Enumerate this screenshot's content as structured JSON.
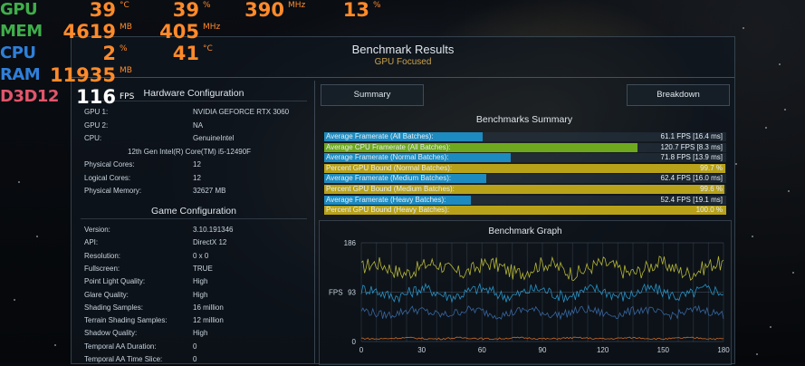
{
  "osd": {
    "rows": [
      {
        "label": "GPU",
        "label_color": "#3fae4a",
        "items": [
          {
            "value": "39",
            "unit": "°C"
          },
          {
            "value": "39",
            "unit": "%"
          },
          {
            "value": "390",
            "unit": "MHz"
          },
          {
            "value": "13",
            "unit": "%"
          }
        ]
      },
      {
        "label": "MEM",
        "label_color": "#3fae4a",
        "items": [
          {
            "value": "4619",
            "unit": "MB"
          },
          {
            "value": "405",
            "unit": "MHz"
          }
        ]
      },
      {
        "label": "CPU",
        "label_color": "#2f7fd8",
        "items": [
          {
            "value": "2",
            "unit": "%"
          },
          {
            "value": "41",
            "unit": "°C"
          }
        ]
      },
      {
        "label": "RAM",
        "label_color": "#2f7fd8",
        "items": [
          {
            "value": "11935",
            "unit": "MB"
          }
        ]
      },
      {
        "label": "D3D12",
        "label_color": "#e0566b",
        "items": [
          {
            "value": "116",
            "unit": "FPS"
          }
        ]
      }
    ],
    "value_color": "#ff8a2a",
    "fps_color": "#ffffff"
  },
  "panel": {
    "title": "Benchmark Results",
    "subtitle": "GPU Focused",
    "hardware_title": "Hardware Configuration",
    "hardware": [
      {
        "k": "GPU 1:",
        "v": "NVIDIA GEFORCE RTX 3060"
      },
      {
        "k": "GPU 2:",
        "v": "NA"
      },
      {
        "k": "CPU:",
        "v": "GenuineIntel"
      },
      {
        "k": "",
        "v": "12th Gen Intel(R) Core(TM) i5-12490F"
      },
      {
        "k": "Physical Cores:",
        "v": "12"
      },
      {
        "k": "Logical Cores:",
        "v": "12"
      },
      {
        "k": "Physical Memory:",
        "v": "32627  MB"
      }
    ],
    "game_title": "Game Configuration",
    "game": [
      {
        "k": "Version:",
        "v": "3.10.191346"
      },
      {
        "k": "API:",
        "v": "DirectX 12"
      },
      {
        "k": "Resolution:",
        "v": "0 x 0"
      },
      {
        "k": "Fullscreen:",
        "v": "TRUE"
      },
      {
        "k": "Point Light Quality:",
        "v": "High"
      },
      {
        "k": "Glare Quality:",
        "v": "High"
      },
      {
        "k": "Shading Samples:",
        "v": "16 million"
      },
      {
        "k": "Terrain Shading Samples:",
        "v": "12 million"
      },
      {
        "k": "Shadow Quality:",
        "v": "High"
      },
      {
        "k": "Temporal AA Duration:",
        "v": "0"
      },
      {
        "k": "Temporal AA Time Slice:",
        "v": "0"
      }
    ],
    "tabs": [
      {
        "label": "Summary"
      },
      {
        "label": "Breakdown"
      }
    ],
    "summary_title": "Benchmarks Summary",
    "bars": [
      {
        "label": "Average Framerate (All Batches):",
        "value": "61.1 FPS [16.4 ms]",
        "fraction": 0.395,
        "color": "#1d8bc0"
      },
      {
        "label": "Average CPU Framerate (All Batches):",
        "value": "120.7 FPS [8.3 ms]",
        "fraction": 0.78,
        "color": "#6ea81f"
      },
      {
        "label": "Average Framerate (Normal Batches):",
        "value": "71.8 FPS [13.9 ms]",
        "fraction": 0.464,
        "color": "#1d8bc0"
      },
      {
        "label": "Percent GPU Bound (Normal Batches):",
        "value": "99.7 %",
        "fraction": 0.997,
        "color": "#b8a21a"
      },
      {
        "label": "Average Framerate (Medium Batches):",
        "value": "62.4 FPS [16.0 ms]",
        "fraction": 0.403,
        "color": "#1d8bc0"
      },
      {
        "label": "Percent GPU Bound (Medium Batches):",
        "value": "99.6 %",
        "fraction": 0.996,
        "color": "#b8a21a"
      },
      {
        "label": "Average Framerate (Heavy Batches):",
        "value": "52.4 FPS [19.1 ms]",
        "fraction": 0.365,
        "color": "#1d8bc0"
      },
      {
        "label": "Percent GPU Bound (Heavy Batches):",
        "value": "100.0 %",
        "fraction": 1.0,
        "color": "#b8a21a"
      }
    ],
    "graph": {
      "title": "Benchmark Graph",
      "ylabel": "FPS",
      "yticks": [
        "186",
        "93",
        "0"
      ],
      "xticks": [
        "0",
        "30",
        "60",
        "90",
        "120",
        "150",
        "180"
      ],
      "ymax": 186,
      "xmax": 180,
      "series": [
        {
          "color": "#c8c83a",
          "mean": 138,
          "amp": 18
        },
        {
          "color": "#2aa0d8",
          "mean": 92,
          "amp": 14
        },
        {
          "color": "#3d6fae",
          "mean": 55,
          "amp": 10
        },
        {
          "color": "#e0762a",
          "mean": 6,
          "amp": 2
        }
      ]
    }
  }
}
